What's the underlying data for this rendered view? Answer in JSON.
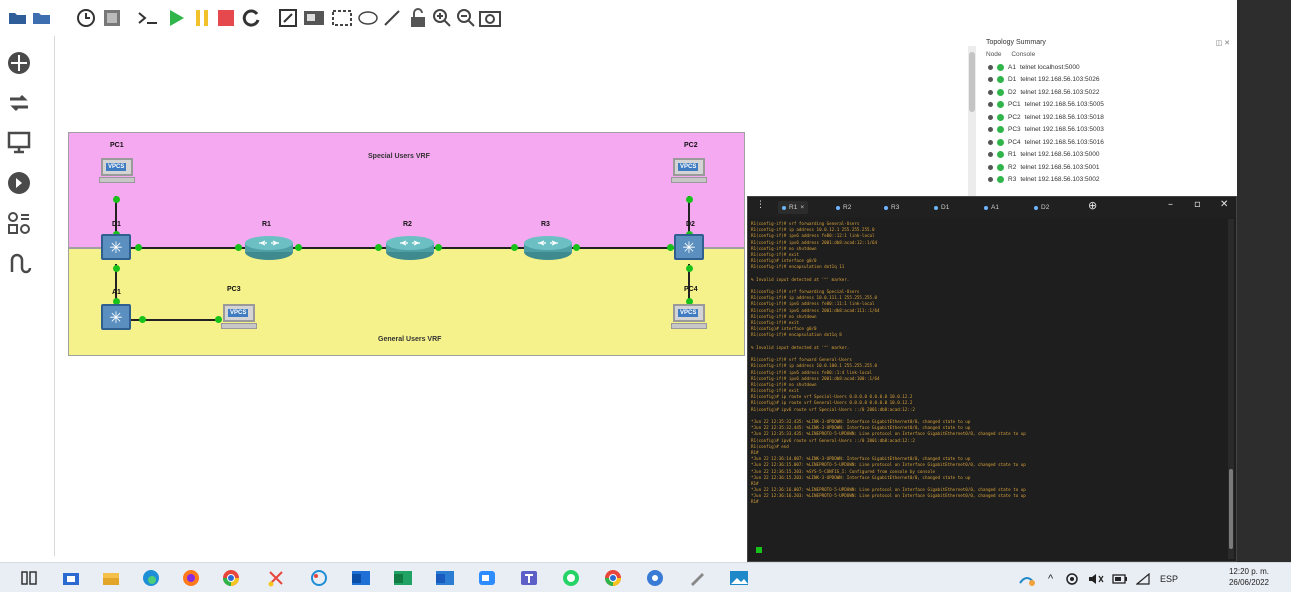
{
  "toolbar": {
    "icons": [
      "folder-open-icon",
      "folder-icon",
      "clock-icon",
      "snapshot-icon",
      "console-icon",
      "start-icon",
      "pause-icon",
      "stop-icon",
      "reload-icon",
      "edit-note-icon",
      "image-icon",
      "rectangle-icon",
      "ellipse-icon",
      "line-icon",
      "lock-icon",
      "zoom-in-icon",
      "zoom-out-icon",
      "screenshot-icon"
    ]
  },
  "palette": {
    "icons": [
      "browse-routers-icon",
      "browse-switches-icon",
      "browse-end-devices-icon",
      "browse-security-icon",
      "browse-all-devices-icon",
      "add-link-icon"
    ]
  },
  "topology": {
    "zones": {
      "special": "Special Users VRF",
      "general": "General Users VRF"
    },
    "nodes": {
      "pc1": "PC1",
      "pc2": "PC2",
      "pc3": "PC3",
      "pc4": "PC4",
      "d1": "D1",
      "d2": "D2",
      "a1": "A1",
      "r1": "R1",
      "r2": "R2",
      "r3": "R3"
    },
    "vpcs_badge": "VPCS"
  },
  "topology_summary": {
    "title": "Topology Summary",
    "controls": "◫ ✕",
    "columns": [
      "Node",
      "Console"
    ],
    "rows": [
      {
        "node": "A1",
        "console": "telnet localhost:5000"
      },
      {
        "node": "D1",
        "console": "telnet 192.168.56.103:5026"
      },
      {
        "node": "D2",
        "console": "telnet 192.168.56.103:5022"
      },
      {
        "node": "PC1",
        "console": "telnet 192.168.56.103:5005"
      },
      {
        "node": "PC2",
        "console": "telnet 192.168.56.103:5018"
      },
      {
        "node": "PC3",
        "console": "telnet 192.168.56.103:5003"
      },
      {
        "node": "PC4",
        "console": "telnet 192.168.56.103:5016"
      },
      {
        "node": "R1",
        "console": "telnet 192.168.56.103:5000"
      },
      {
        "node": "R2",
        "console": "telnet 192.168.56.103:5001"
      },
      {
        "node": "R3",
        "console": "telnet 192.168.56.103:5002"
      }
    ]
  },
  "terminal": {
    "menu": "⋮",
    "tabs": [
      "R1",
      "R2",
      "R3",
      "D1",
      "A1",
      "D2"
    ],
    "tab_close": "×",
    "new_tab": "⊕",
    "minimize": "–",
    "maximize": "▫",
    "close": "✕",
    "lines": [
      "R1(config-if)# vrf forwarding General-Users",
      "R1(config-if)# ip address 10.0.12.1 255.255.255.0",
      "R1(config-if)# ipv6 address fe80::12:1 link-local",
      "R1(config-if)# ipv6 address 2001:db8:acad:12::1/64",
      "R1(config-if)# no shutdown",
      "R1(config-if)# exit",
      "R1(config)# interface g0/0",
      "R1(config-if)# encapsulation dot1q 11",
      "",
      "% Invalid input detected at '^' marker.",
      "",
      "R1(config-if)# vrf forwarding Special-Users",
      "R1(config-if)# ip address 10.0.111.1 255.255.255.0",
      "R1(config-if)# ipv6 address fe80::11:1 link-local",
      "R1(config-if)# ipv6 address 2001:db8:acad:111::1/64",
      "R1(config-if)# no shutdown",
      "R1(config-if)# exit",
      "R1(config)# interface g0/0",
      "R1(config-if)# encapsulation dot1q 8",
      "",
      "% Invalid input detected at '^' marker.",
      "",
      "R1(config-if)# vrf forward General-Users",
      "R1(config-if)# ip address 10.0.100.1 255.255.255.0",
      "R1(config-if)# ipv6 address fe80::1:4 link-local",
      "R1(config-if)# ipv6 address 2001:db8:acad:100::1/64",
      "R1(config-if)# no shutdown",
      "R1(config-if)# exit",
      "R1(config)# ip route vrf Special-Users 0.0.0.0 0.0.0.0 10.0.12.2",
      "R1(config)# ip route vrf General-Users 0.0.0.0 0.0.0.0 10.0.12.2",
      "R1(config)# ipv6 route vrf Special-Users ::/0 2001:db8:acad:12::2",
      "",
      "*Jun 22 12:35:32.435: %LINK-3-UPDOWN: Interface GigabitEthernet0/0, changed state to up",
      "*Jun 22 12:35:32.445: %LINK-3-UPDOWN: Interface GigabitEthernet0/0, changed state to up",
      "*Jun 22 12:35:33.435: %LINEPROTO-5-UPDOWN: Line protocol on Interface GigabitEthernet0/0, changed state to up",
      "R1(config)# ipv6 route vrf General-Users ::/0 2001:db8:acad:12::2",
      "R1(config)# end",
      "R1#",
      "*Jun 22 12:36:14.007: %LINK-3-UPDOWN: Interface GigabitEthernet0/0, changed state to up",
      "*Jun 22 12:36:15.007: %LINEPROTO-5-UPDOWN: Line protocol on Interface GigabitEthernet0/0, changed state to up",
      "*Jun 22 12:36:15.203: %SYS-5-CONFIG_I: Configured from console by console",
      "*Jun 22 12:36:15.203: %LINK-3-UPDOWN: Interface GigabitEthernet0/0, changed state to up",
      "R1#",
      "*Jun 22 12:36:16.007: %LINEPROTO-5-UPDOWN: Line protocol on Interface GigabitEthernet0/0, changed state to up",
      "*Jun 22 12:36:16.203: %LINEPROTO-5-UPDOWN: Line protocol on Interface GigabitEthernet0/0, changed state to up",
      "R1#"
    ]
  },
  "taskbar": {
    "apps": [
      "task-view-icon",
      "store-icon",
      "file-explorer-icon",
      "edge-icon",
      "firefox-icon",
      "chrome-icon",
      "snipping-icon",
      "paint-icon",
      "outlook-icon",
      "excel-icon",
      "word-icon",
      "zoom-icon",
      "teams-icon",
      "whatsapp-icon",
      "chrome-alt-icon",
      "gns3-icon",
      "pen-icon",
      "photos-icon"
    ],
    "tray_expand": "^",
    "language": "ESP",
    "time": "12:20 p. m.",
    "date": "26/06/2022"
  }
}
